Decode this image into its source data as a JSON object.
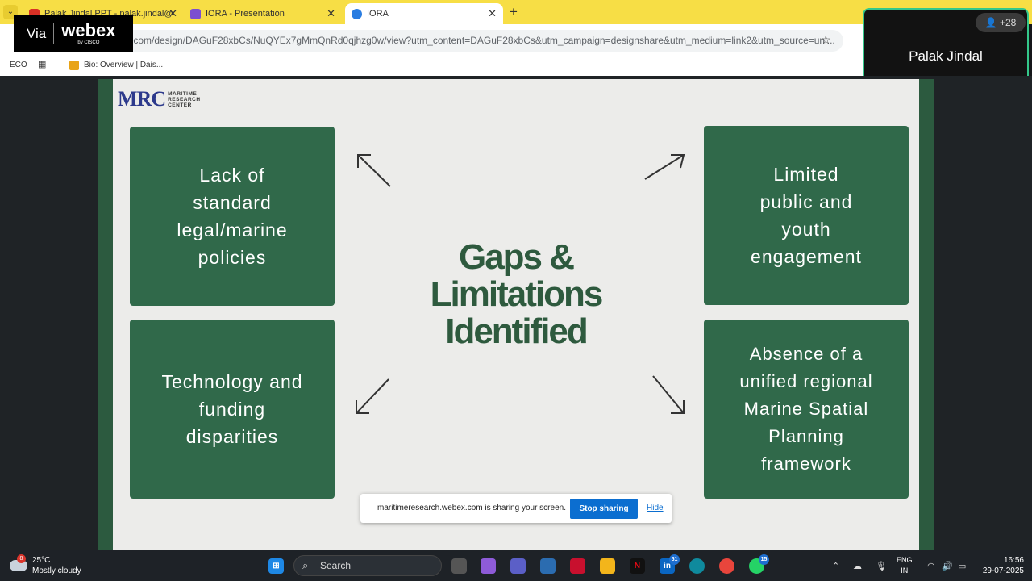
{
  "browser": {
    "tabs": [
      {
        "label": "Palak Jindal PPT - palak.jindal@",
        "favicon_color": "#d93025"
      },
      {
        "label": "IORA - Presentation",
        "favicon_color": "#7b4fd1"
      },
      {
        "label": "IORA",
        "favicon_color": "#2a7de1"
      }
    ],
    "url": ".com/design/DAGuF28xbCs/NuQYEx7gMmQnRd0qjhzg0w/view?utm_content=DAGuF28xbCs&utm_campaign=designshare&utm_medium=link2&utm_source=uni...",
    "bookmarks": [
      {
        "label": "ECO"
      },
      {
        "label": "Bio: Overview | Dais..."
      }
    ]
  },
  "webex": {
    "via": "Via",
    "brand": "webex",
    "sub": "by CISCO",
    "participant_name": "Palak Jindal",
    "participant_count": "+28"
  },
  "slide": {
    "logo_mark": "MRC",
    "logo_text": "MARITIME\nRESEARCH\nCENTER",
    "title": "Gaps &\nLimitations\nIdentified",
    "boxes": {
      "top_left": "Lack of\nstandard\nlegal/marine\npolicies",
      "top_right": "Limited\npublic and\nyouth\nengagement",
      "bottom_left": "Technology and\nfunding\ndisparities",
      "bottom_right": "Absence of a\nunified regional\nMarine Spatial\nPlanning\nframework"
    },
    "colors": {
      "box": "#30694a",
      "title": "#2e5a3e",
      "border": "#2c5a3f"
    }
  },
  "share_toast": {
    "message": "maritimeresearch.webex.com is sharing your screen.",
    "stop_label": "Stop sharing",
    "hide_label": "Hide"
  },
  "taskbar": {
    "weather_temp": "25°C",
    "weather_desc": "Mostly cloudy",
    "weather_badge": "8",
    "search_placeholder": "Search",
    "badges": {
      "linkedin": "51",
      "whatsapp": "15"
    },
    "lang_top": "ENG",
    "lang_bottom": "IN",
    "time": "16:56",
    "date": "29-07-2025"
  }
}
